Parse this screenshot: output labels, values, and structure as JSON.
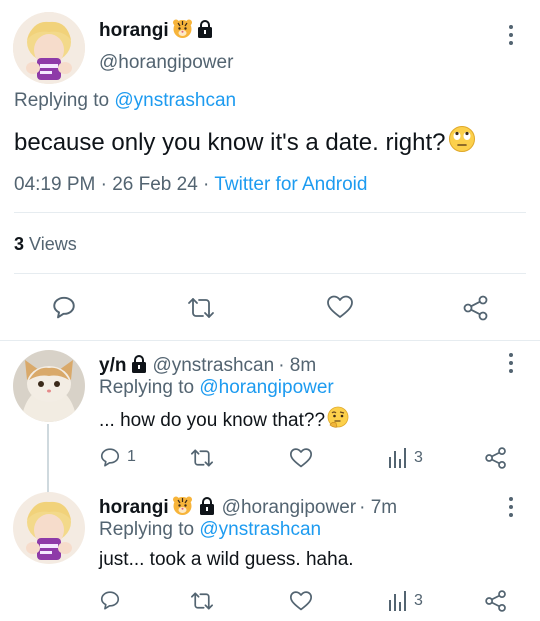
{
  "main_tweet": {
    "display_name": "horangi",
    "handle": "@horangipower",
    "replying_prefix": "Replying to ",
    "replying_to": "@ynstrashcan",
    "text": "because only you know it's a date. right?",
    "time": "04:19 PM · 26 Feb 24 · ",
    "client": "Twitter for Android",
    "views_count": "3",
    "views_label": "Views"
  },
  "replies": [
    {
      "display_name": "y/n",
      "handle": "@ynstrashcan",
      "time": " · 8m",
      "replying_prefix": "Replying to ",
      "replying_to": "@horangipower",
      "text": "... how do you know that??",
      "reply_count": "1",
      "view_count": "3"
    },
    {
      "display_name": "horangi",
      "handle": "@horangipower",
      "time": " · 7m",
      "replying_prefix": "Replying to ",
      "replying_to": "@ynstrashcan",
      "text": "just... took a wild guess. haha.",
      "reply_count": "",
      "view_count": "3"
    }
  ],
  "icons": {
    "reply": "reply-icon",
    "retweet": "retweet-icon",
    "like": "heart-icon",
    "share": "share-icon",
    "views": "views-icon",
    "more": "more-icon",
    "lock": "lock-icon",
    "tiger": "tiger-emoji",
    "eye_roll": "eye-roll-emoji",
    "thinking": "thinking-emoji"
  },
  "colors": {
    "text": "#0f1419",
    "secondary": "#536471",
    "link": "#1d9bf0",
    "divider": "#e6ecf0"
  }
}
